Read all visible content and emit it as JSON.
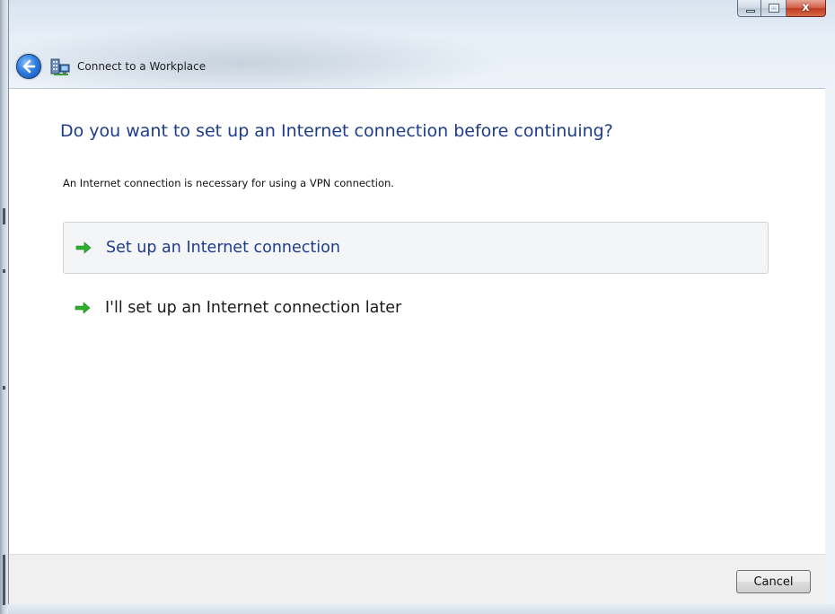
{
  "window": {
    "title": "Connect to a Workplace",
    "caption_buttons": [
      "minimize",
      "maximize",
      "close"
    ]
  },
  "icons": {
    "back": "back-arrow-icon",
    "app": "workplace-network-icon",
    "option_arrow": "green-arrow-icon"
  },
  "content": {
    "heading": "Do you want to set up an Internet connection before continuing?",
    "description": "An Internet connection is necessary for using a VPN connection.",
    "options": [
      {
        "label": "Set up an Internet connection",
        "selected": true
      },
      {
        "label": "I'll set up an Internet connection later",
        "selected": false
      }
    ]
  },
  "footer": {
    "cancel_label": "Cancel"
  },
  "colors": {
    "heading": "#1e3c8c",
    "arrow": "#2bb02b",
    "close_button": "#c9432a"
  }
}
